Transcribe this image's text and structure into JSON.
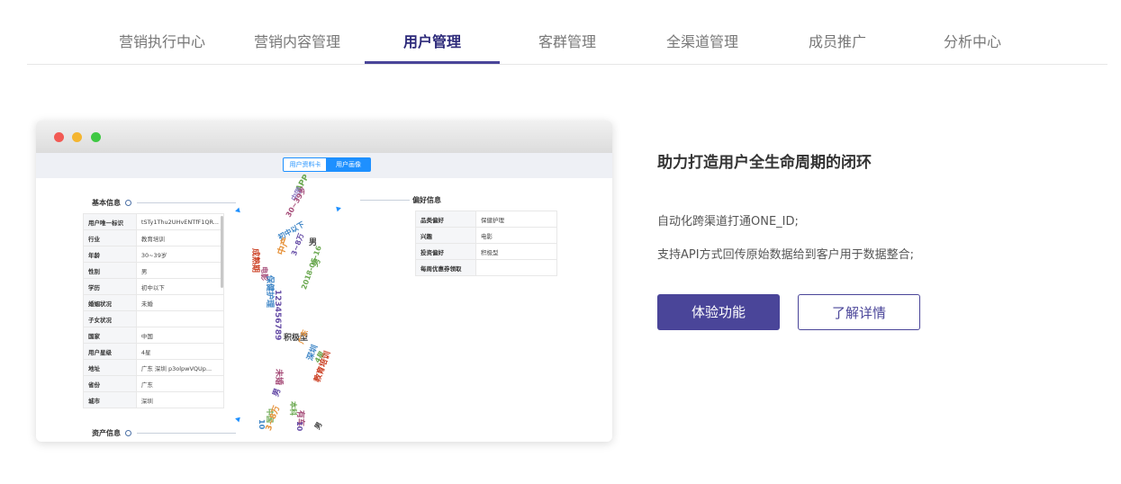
{
  "tabs": [
    {
      "label": "营销执行中心"
    },
    {
      "label": "营销内容管理"
    },
    {
      "label": "用户管理",
      "active": true
    },
    {
      "label": "客群管理"
    },
    {
      "label": "全渠道管理"
    },
    {
      "label": "成员推广"
    },
    {
      "label": "分析中心"
    }
  ],
  "colors": {
    "accent": "#4a4599",
    "tab_active": "#2d2a7a",
    "mock_accent": "#1e90ff",
    "dot_red": "#f25a54",
    "dot_yellow": "#f4b530",
    "dot_green": "#3fc843"
  },
  "mockup": {
    "segment": {
      "left": "用户资料卡",
      "right": "用户画像",
      "selected": "用户画像"
    },
    "basic_title": "基本信息",
    "basic_rows": [
      {
        "k": "用户唯一标识",
        "v": "tSTy1Thu2UHvENTfF1QR..."
      },
      {
        "k": "行业",
        "v": "教育培训"
      },
      {
        "k": "年龄",
        "v": "30~39岁"
      },
      {
        "k": "性别",
        "v": "男"
      },
      {
        "k": "学历",
        "v": "初中以下"
      },
      {
        "k": "婚姻状况",
        "v": "未婚"
      },
      {
        "k": "子女状况",
        "v": ""
      },
      {
        "k": "国家",
        "v": "中国"
      },
      {
        "k": "用户星级",
        "v": "4星"
      },
      {
        "k": "地址",
        "v": "广东 深圳 p3olpwVQUp..."
      },
      {
        "k": "省份",
        "v": "广东"
      },
      {
        "k": "城市",
        "v": "深圳"
      }
    ],
    "asset_title": "资产信息",
    "pref_title": "偏好信息",
    "pref_rows": [
      {
        "k": "品类偏好",
        "v": "保健护理"
      },
      {
        "k": "兴趣",
        "v": "电影"
      },
      {
        "k": "投资偏好",
        "v": "积极型"
      },
      {
        "k": "每周优惠券领取",
        "v": ""
      }
    ],
    "cloud_words": [
      {
        "t": "APP",
        "c": "#6aa84f"
      },
      {
        "t": "中国",
        "c": "#8e7cc3"
      },
      {
        "t": "30~39岁",
        "c": "#a64d79"
      },
      {
        "t": "初中以下",
        "c": "#3d85c6"
      },
      {
        "t": "男",
        "c": "#444"
      },
      {
        "t": "成熟期",
        "c": "#cc4125"
      },
      {
        "t": "中产",
        "c": "#e69138"
      },
      {
        "t": "3~8万",
        "c": "#674ea7"
      },
      {
        "t": "男",
        "c": "#6aa84f"
      },
      {
        "t": "电影",
        "c": "#a64d79"
      },
      {
        "t": "保健护理",
        "c": "#3d85c6"
      },
      {
        "t": "2018-05-16",
        "c": "#6aa84f"
      },
      {
        "t": "123456789",
        "c": "#674ea7"
      },
      {
        "t": "积极型",
        "c": "#444"
      },
      {
        "t": "广东",
        "c": "#e69138"
      },
      {
        "t": "深圳",
        "c": "#3d85c6"
      },
      {
        "t": "4星",
        "c": "#6aa84f"
      },
      {
        "t": "未婚",
        "c": "#a64d79"
      },
      {
        "t": "教育培训",
        "c": "#cc4125"
      },
      {
        "t": "男",
        "c": "#674ea7"
      },
      {
        "t": "中国",
        "c": "#6aa84f"
      },
      {
        "t": "有车",
        "c": "#a64d79"
      },
      {
        "t": "10",
        "c": "#3d85c6"
      },
      {
        "t": "3~8万",
        "c": "#e69138"
      },
      {
        "t": "男",
        "c": "#444"
      },
      {
        "t": "10",
        "c": "#674ea7"
      },
      {
        "t": "本科",
        "c": "#6aa84f"
      }
    ]
  },
  "content": {
    "title": "助力打造用户全生命周期的闭环",
    "desc1": "自动化跨渠道打通ONE_ID;",
    "desc2": "支持API方式回传原始数据给到客户用于数据整合;",
    "primary_btn": "体验功能",
    "secondary_btn": "了解详情"
  }
}
